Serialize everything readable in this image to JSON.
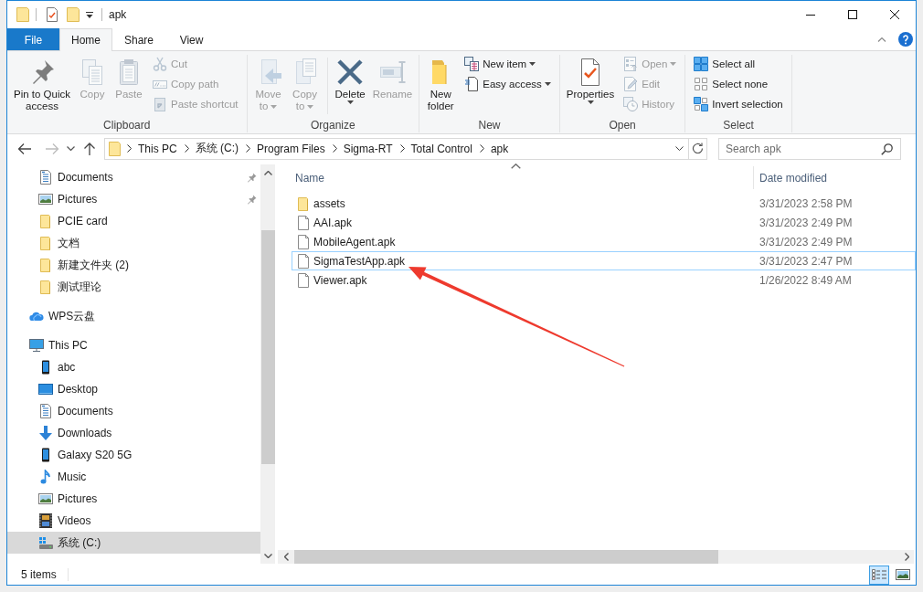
{
  "window": {
    "title": "apk"
  },
  "ribbon": {
    "tabs": [
      {
        "label": "File",
        "kind": "file",
        "selected": false
      },
      {
        "label": "Home",
        "kind": "tab",
        "selected": true
      },
      {
        "label": "Share",
        "kind": "tab",
        "selected": false
      },
      {
        "label": "View",
        "kind": "tab",
        "selected": false
      }
    ],
    "groups": [
      {
        "label": "Clipboard",
        "large_commands": [
          {
            "kind": "pin",
            "lines": [
              "Pin to Quick",
              "access"
            ],
            "disabled": false,
            "dropdown": false
          },
          {
            "kind": "copy",
            "lines": [
              "Copy"
            ],
            "disabled": true,
            "dropdown": false
          },
          {
            "kind": "paste",
            "lines": [
              "Paste"
            ],
            "disabled": true,
            "dropdown": false
          }
        ],
        "small_commands": [
          {
            "kind": "cut",
            "label": "Cut",
            "disabled": true,
            "dropdown": false
          },
          {
            "kind": "copy_path",
            "label": "Copy path",
            "disabled": true,
            "dropdown": false
          },
          {
            "kind": "paste_shortcut",
            "label": "Paste shortcut",
            "disabled": true,
            "dropdown": false
          }
        ]
      },
      {
        "label": "Organize",
        "large_commands": [
          {
            "kind": "move_to",
            "lines": [
              "Move",
              "to"
            ],
            "disabled": true,
            "dropdown": true
          },
          {
            "kind": "copy_to",
            "lines": [
              "Copy",
              "to"
            ],
            "disabled": true,
            "dropdown": true
          },
          {
            "kind": "delete",
            "lines": [
              "Delete"
            ],
            "disabled": false,
            "dropdown": true,
            "separator_before": true
          },
          {
            "kind": "rename",
            "lines": [
              "Rename"
            ],
            "disabled": true,
            "dropdown": false
          }
        ]
      },
      {
        "label": "New",
        "large_commands": [
          {
            "kind": "new_folder",
            "lines": [
              "New",
              "folder"
            ],
            "disabled": false,
            "dropdown": false
          }
        ],
        "small_commands": [
          {
            "kind": "new_item",
            "label": "New item",
            "disabled": false,
            "dropdown": true
          },
          {
            "kind": "easy_access",
            "label": "Easy access",
            "disabled": false,
            "dropdown": true
          }
        ]
      },
      {
        "label": "Open",
        "large_commands": [
          {
            "kind": "properties",
            "lines": [
              "Properties"
            ],
            "disabled": false,
            "dropdown": true
          }
        ],
        "small_commands": [
          {
            "kind": "open",
            "label": "Open",
            "disabled": true,
            "dropdown": true
          },
          {
            "kind": "edit",
            "label": "Edit",
            "disabled": true,
            "dropdown": false
          },
          {
            "kind": "history",
            "label": "History",
            "disabled": true,
            "dropdown": false
          }
        ]
      },
      {
        "label": "Select",
        "small_commands": [
          {
            "kind": "select_all",
            "label": "Select all",
            "disabled": false,
            "dropdown": false
          },
          {
            "kind": "select_none",
            "label": "Select none",
            "disabled": false,
            "dropdown": false
          },
          {
            "kind": "invert_selection",
            "label": "Invert selection",
            "disabled": false,
            "dropdown": false
          }
        ]
      }
    ]
  },
  "nav_buttons": [
    {
      "kind": "back",
      "disabled": false
    },
    {
      "kind": "forward",
      "disabled": true
    },
    {
      "kind": "recent",
      "disabled": false
    },
    {
      "kind": "up",
      "disabled": false
    }
  ],
  "address_bar": {
    "crumbs": [
      "This PC",
      "系统 (C:)",
      "Program Files",
      "Sigma-RT",
      "Total Control",
      "apk"
    ]
  },
  "search": {
    "placeholder": "Search apk"
  },
  "navigation_pane": {
    "items": [
      {
        "children": [
          {
            "label": "Documents",
            "kind": "documents",
            "pinned": true,
            "selected": false
          },
          {
            "label": "Pictures",
            "kind": "pictures",
            "pinned": true,
            "selected": false
          },
          {
            "label": "PCIE card",
            "kind": "folder",
            "pinned": false,
            "selected": false
          },
          {
            "label": "文档",
            "kind": "folder",
            "pinned": false,
            "selected": false
          },
          {
            "label": "新建文件夹 (2)",
            "kind": "folder",
            "pinned": false,
            "selected": false
          },
          {
            "label": "测试理论",
            "kind": "folder",
            "pinned": false,
            "selected": false
          }
        ]
      },
      {
        "label": "WPS云盘",
        "kind": "cloud",
        "selected": false
      },
      {
        "label": "This PC",
        "kind": "computer",
        "selected": false,
        "children": [
          {
            "label": "abc",
            "kind": "phone",
            "selected": false
          },
          {
            "label": "Desktop",
            "kind": "desktop",
            "selected": false
          },
          {
            "label": "Documents",
            "kind": "documents",
            "selected": false
          },
          {
            "label": "Downloads",
            "kind": "downloads",
            "selected": false
          },
          {
            "label": "Galaxy S20 5G",
            "kind": "phone",
            "selected": false
          },
          {
            "label": "Music",
            "kind": "music",
            "selected": false
          },
          {
            "label": "Pictures",
            "kind": "pictures",
            "selected": false
          },
          {
            "label": "Videos",
            "kind": "videos",
            "selected": false
          },
          {
            "label": "系统 (C:)",
            "kind": "drive",
            "selected": true
          }
        ]
      }
    ]
  },
  "file_list": {
    "columns": [
      {
        "label": "Name",
        "sorted": true
      },
      {
        "label": "Date modified",
        "sorted": false
      }
    ],
    "rows": [
      {
        "name": "assets",
        "kind": "folder",
        "date_modified": "3/31/2023 2:58 PM",
        "focused": false
      },
      {
        "name": "AAI.apk",
        "kind": "file",
        "date_modified": "3/31/2023 2:49 PM",
        "focused": false
      },
      {
        "name": "MobileAgent.apk",
        "kind": "file",
        "date_modified": "3/31/2023 2:49 PM",
        "focused": false
      },
      {
        "name": "SigmaTestApp.apk",
        "kind": "file",
        "date_modified": "3/31/2023 2:47 PM",
        "focused": true
      },
      {
        "name": "Viewer.apk",
        "kind": "file",
        "date_modified": "1/26/2022 8:49 AM",
        "focused": false
      }
    ]
  },
  "annotations": [
    {
      "kind": "arrow"
    }
  ],
  "status_bar": {
    "item_count": "5 items",
    "views": [
      {
        "kind": "details",
        "selected": true
      },
      {
        "kind": "large_icons",
        "selected": false
      }
    ]
  }
}
